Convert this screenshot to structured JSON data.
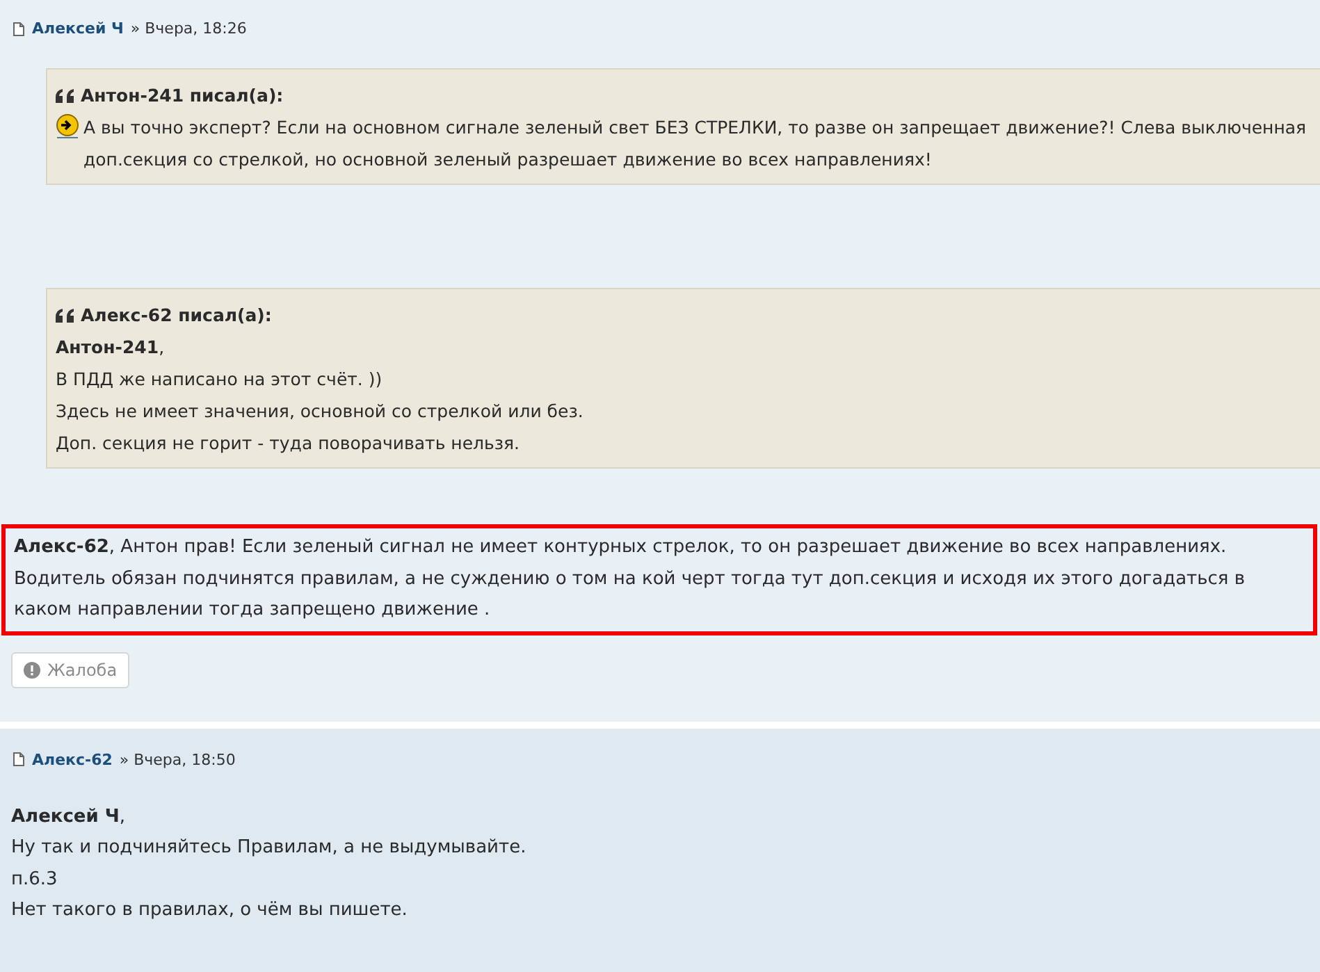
{
  "posts": [
    {
      "author": "Алексей Ч",
      "date": "» Вчера, 18:26",
      "quotes": [
        {
          "header": "Антон-241 писал(а):",
          "lines": [
            {
              "text": "А вы точно эксперт? Если на основном сигнале зеленый свет БЕЗ СТРЕЛКИ, то разве он запрещает движение?! Слева выключенная доп.секция со стрелкой, но основной зеленый разрешает движение во всех направлениях!",
              "emoticon": true
            }
          ]
        },
        {
          "header": "Алекс-62 писал(а):",
          "lines": [
            {
              "text": "**Антон-241**,",
              "emoticon": false
            },
            {
              "text": "В ПДД же написано на этот счёт. ))",
              "emoticon": false
            },
            {
              "text": "Здесь не имеет значения, основной со стрелкой или без.",
              "emoticon": false
            },
            {
              "text": "Доп. секция не горит - туда поворачивать нельзя.",
              "emoticon": false
            }
          ]
        }
      ],
      "body": [
        "**Алекс-62**, Антон прав! Если зеленый сигнал не имеет контурных стрелок, то он разрешает движение во всех направлениях. Водитель обязан подчинятся правилам, а не суждению о том на кой черт тогда тут доп.секция и исходя их этого догадаться в каком направлении тогда запрещено движение ."
      ],
      "highlighted": true,
      "report_button": "Жалоба"
    },
    {
      "author": "Алекс-62",
      "date": "» Вчера, 18:50",
      "body": [
        "**Алексей Ч**,",
        "Ну так и подчиняйтесь Правилам, а не выдумывайте.",
        "п.6.3",
        "Нет такого в правилах, о чём вы пишете."
      ],
      "highlighted": false
    }
  ]
}
